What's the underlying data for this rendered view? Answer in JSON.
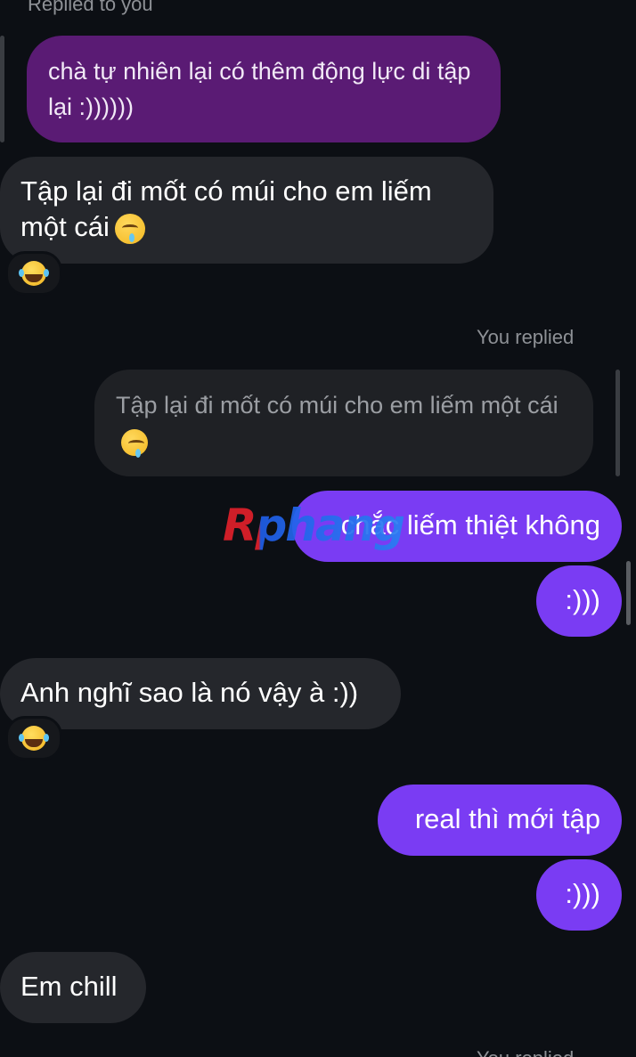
{
  "thread": {
    "top_reply_label": "Replied to you",
    "you_replied_label": "You replied",
    "bottom_label": "You replied",
    "messages": {
      "quoted_incoming": "chà tự nhiên lại có thêm động lực di tập lại :))))))",
      "msg1": "Tập lại đi mốt có múi cho em liếm một cái",
      "quoted_outgoing": "Tập lại đi mốt có múi cho em liếm một cái",
      "msg2": "chắc liếm thiệt không",
      "msg3": ":)))",
      "msg4": "Anh nghĩ sao là nó vậy à :))",
      "msg5": "real thì mới tập",
      "msg6": ":)))",
      "msg7": "Em chill"
    },
    "reactions": {
      "msg1": "face-with-tears-of-joy-icon",
      "msg4": "face-with-tears-of-joy-icon"
    },
    "emoji": {
      "drooling": "drooling-face-icon"
    }
  },
  "watermark": {
    "text": "Rphang"
  },
  "colors": {
    "background": "#0c0f14",
    "incoming_bubble": "#25272c",
    "outgoing_bubble": "#7a3cf3",
    "quoted_incoming_bubble": "#5a1b74",
    "quoted_outgoing_bubble": "#1f2125",
    "meta_text": "#8e9196"
  }
}
